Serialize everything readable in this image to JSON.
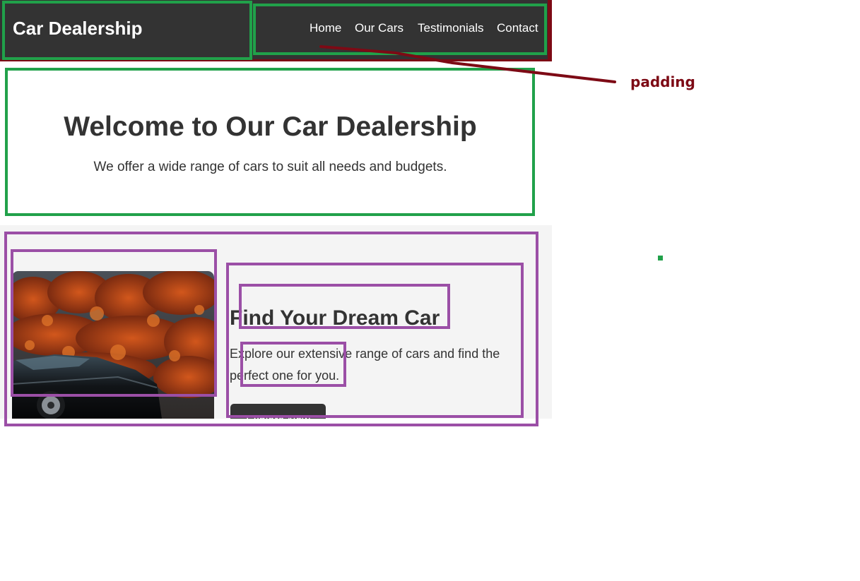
{
  "header": {
    "logo": "Car Dealership",
    "nav": [
      {
        "label": "Home"
      },
      {
        "label": "Our Cars"
      },
      {
        "label": "Testimonials"
      },
      {
        "label": "Contact"
      }
    ]
  },
  "hero": {
    "title": "Welcome to Our Car Dealership",
    "subtitle": "We offer a wide range of cars to suit all needs and budgets."
  },
  "feature": {
    "title": "Find Your Dream Car",
    "text": "Explore our extensive range of cars and find the perfect one for you.",
    "button_label": "Explore Now"
  },
  "annotations": {
    "padding_label": "padding"
  },
  "colors": {
    "header_bg": "#333333",
    "annotation_red": "#7d0a15",
    "annotation_green": "#21a14a",
    "annotation_purple": "#9b4fa6",
    "section_bg": "#f4f4f4"
  }
}
